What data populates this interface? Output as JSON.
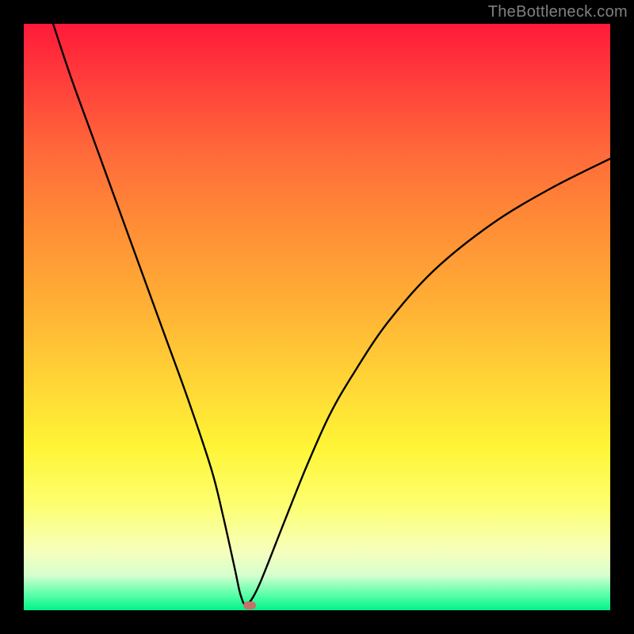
{
  "watermark": "TheBottleneck.com",
  "chart_data": {
    "type": "line",
    "title": "",
    "xlabel": "",
    "ylabel": "",
    "xlim": [
      0,
      100
    ],
    "ylim": [
      0,
      100
    ],
    "series": [
      {
        "name": "bottleneck-curve",
        "x": [
          5,
          8,
          12,
          16,
          20,
          24,
          28,
          32,
          34,
          36,
          37,
          38,
          40,
          44,
          48,
          52,
          56,
          62,
          70,
          80,
          90,
          100
        ],
        "y": [
          100,
          91,
          80,
          69,
          58,
          47,
          36,
          24,
          16,
          7,
          2.5,
          1,
          4,
          14,
          24,
          33,
          40,
          49,
          58,
          66,
          72,
          77
        ]
      }
    ],
    "marker": {
      "name": "selected-point",
      "x": 38.5,
      "y": 0.8,
      "color": "#c6706c"
    },
    "gradient_stops": [
      {
        "pos": 0,
        "color": "#ff1a3a"
      },
      {
        "pos": 10,
        "color": "#ff3f3b"
      },
      {
        "pos": 22,
        "color": "#ff6a3a"
      },
      {
        "pos": 34,
        "color": "#ff8c36"
      },
      {
        "pos": 48,
        "color": "#ffb035"
      },
      {
        "pos": 60,
        "color": "#ffd236"
      },
      {
        "pos": 72,
        "color": "#fff436"
      },
      {
        "pos": 82,
        "color": "#fdff70"
      },
      {
        "pos": 90,
        "color": "#f6ffbd"
      },
      {
        "pos": 94,
        "color": "#d6ffce"
      },
      {
        "pos": 97.5,
        "color": "#54ffa7"
      },
      {
        "pos": 100,
        "color": "#02f18a"
      }
    ]
  }
}
